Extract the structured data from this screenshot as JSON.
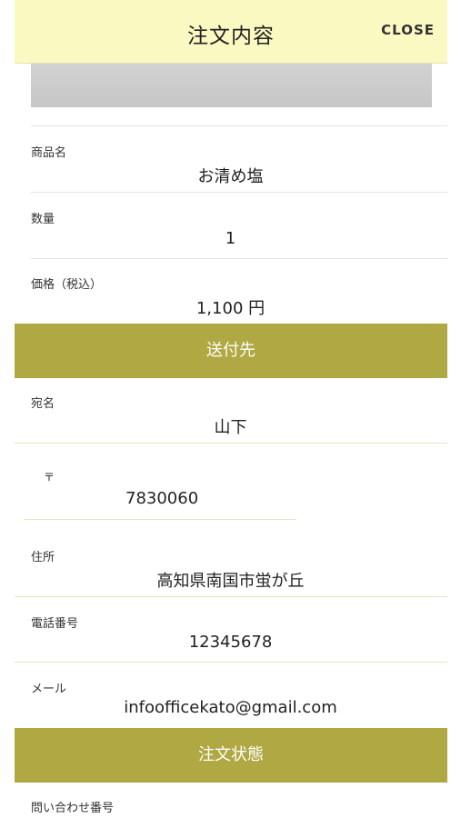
{
  "header": {
    "title": "注文内容",
    "close_label": "CLOSE"
  },
  "order": {
    "product_name": {
      "label": "商品名",
      "value": "お清め塩"
    },
    "quantity": {
      "label": "数量",
      "value": "1"
    },
    "price": {
      "label": "価格（税込）",
      "value": "1,100 円"
    }
  },
  "shipping": {
    "section_title": "送付先",
    "recipient": {
      "label": "宛名",
      "value": "山下"
    },
    "postal_code": {
      "label": "〒",
      "value": "7830060"
    },
    "address": {
      "label": "住所",
      "value": "高知県南国市蛍が丘"
    },
    "phone": {
      "label": "電話番号",
      "value": "12345678"
    },
    "email": {
      "label": "メール",
      "value": "infoofficekato@gmail.com"
    }
  },
  "status": {
    "section_title": "注文状態",
    "inquiry_number": {
      "label": "問い合わせ番号"
    }
  }
}
